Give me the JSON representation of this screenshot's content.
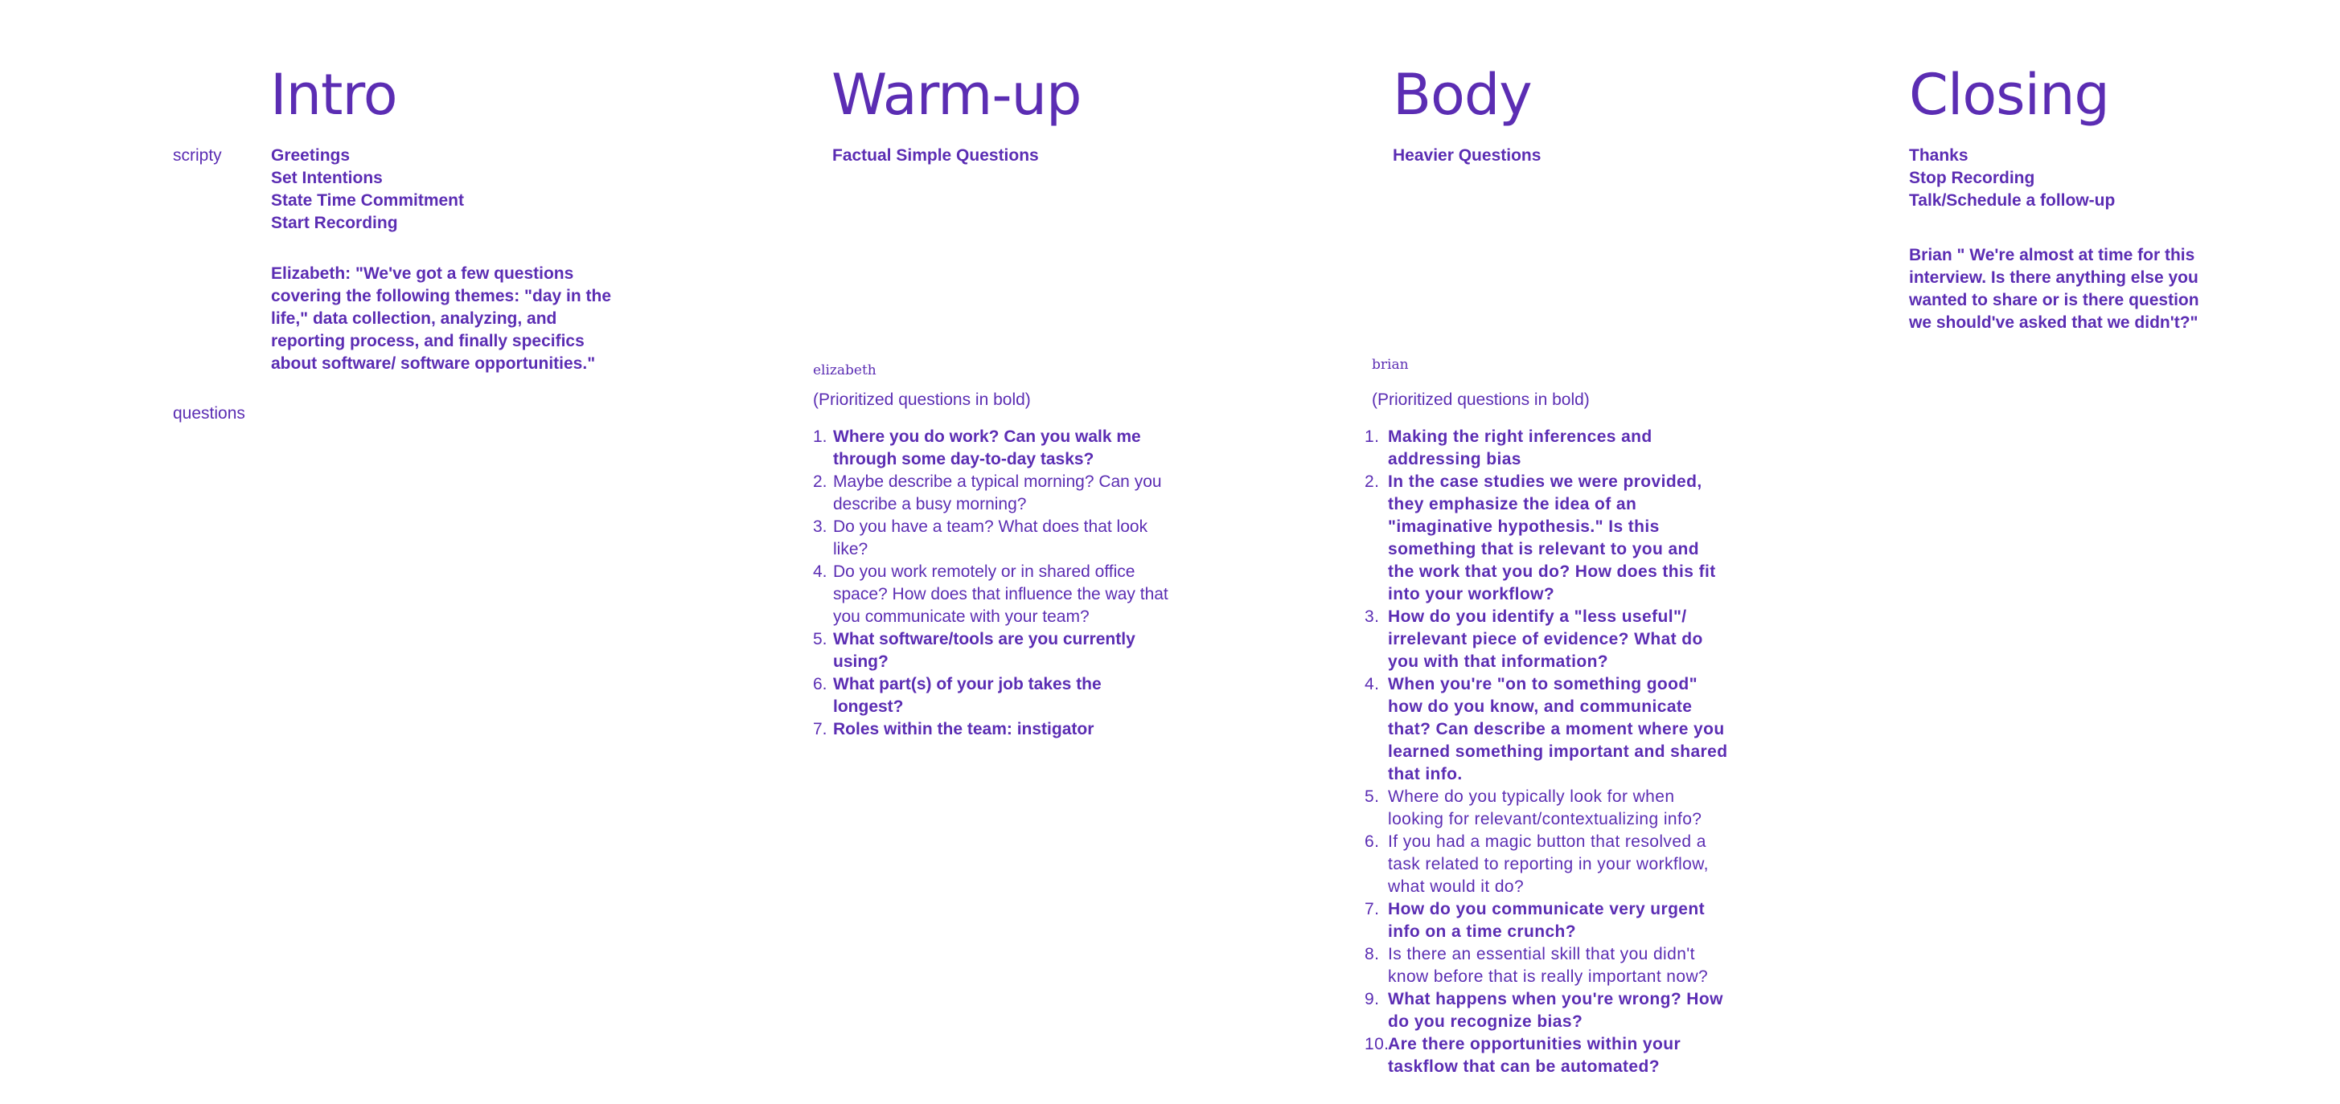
{
  "side_labels": {
    "scripty": "scripty",
    "questions": "questions"
  },
  "intro": {
    "title": "Intro",
    "items": [
      "Greetings",
      "Set Intentions",
      "State Time Commitment",
      "Start Recording"
    ],
    "script": "Elizabeth: \"We've got a few questions covering the following themes: \"day in the life,\" data collection, analyzing, and reporting process, and finally specifics about software/ software opportunities.\""
  },
  "warmup": {
    "title": "Warm-up",
    "subtitle": "Factual Simple Questions",
    "author": "elizabeth",
    "note": "(Prioritized questions in bold)",
    "questions": [
      {
        "n": "1.",
        "text": "Where you do work? Can you walk me through some day-to-day tasks?",
        "bold": true
      },
      {
        "n": "2.",
        "text": "Maybe describe a typical morning? Can you describe a busy morning?",
        "bold": false
      },
      {
        "n": "3.",
        "text": "Do you have a team? What does that look like?",
        "bold": false
      },
      {
        "n": "4.",
        "text": "Do you work remotely or in shared office space? How does that influence the way that you communicate with your team?",
        "bold": false
      },
      {
        "n": "5.",
        "text": "What software/tools are you currently using?",
        "bold": true
      },
      {
        "n": "6.",
        "text": "What part(s) of your job takes the longest?",
        "bold": true
      },
      {
        "n": "7.",
        "text": "Roles within the team: instigator",
        "bold": true
      }
    ]
  },
  "body": {
    "title": "Body",
    "subtitle": "Heavier Questions",
    "author": "brian",
    "note": "(Prioritized questions in bold)",
    "questions": [
      {
        "n": "1.",
        "text": "Making the right inferences and addressing bias",
        "bold": true
      },
      {
        "n": "2.",
        "text": "In the case studies we were provided, they emphasize the idea of an \"imaginative hypothesis.\" Is this something that is relevant to you and the work that you do? How does this fit into your workflow?",
        "bold": true
      },
      {
        "n": "3.",
        "text": "How do you identify a \"less useful\"/ irrelevant piece of evidence? What do you with that information?",
        "bold": true
      },
      {
        "n": "4.",
        "text": "When you're \"on to something good\" how do you know, and communicate that? Can describe a moment where you learned something important and shared that info.",
        "bold": true
      },
      {
        "n": "5.",
        "text": "Where do you typically look for when looking for relevant/contextualizing info?",
        "bold": false
      },
      {
        "n": "6.",
        "text": "If you had a magic button that resolved a task related to reporting in your workflow, what would it do?",
        "bold": false
      },
      {
        "n": "7.",
        "text": "How do you communicate very urgent info on a time crunch?",
        "bold": true
      },
      {
        "n": "8.",
        "text": "Is there an essential skill that you didn't know before that is really important now?",
        "bold": false
      },
      {
        "n": "9.",
        "text": "What happens when you're wrong? How do you recognize bias?",
        "bold": true
      },
      {
        "n": "10.",
        "text": "Are there opportunities within your taskflow that can be automated?",
        "bold": true
      }
    ]
  },
  "closing": {
    "title": "Closing",
    "items": [
      "Thanks",
      "Stop Recording",
      "Talk/Schedule a follow-up"
    ],
    "script": "Brian \" We're almost at time for this interview. Is there anything else you wanted to share or is there question we should've asked that we didn't?\""
  },
  "colors": {
    "text": "#5b2db3",
    "background": "#ffffff"
  }
}
